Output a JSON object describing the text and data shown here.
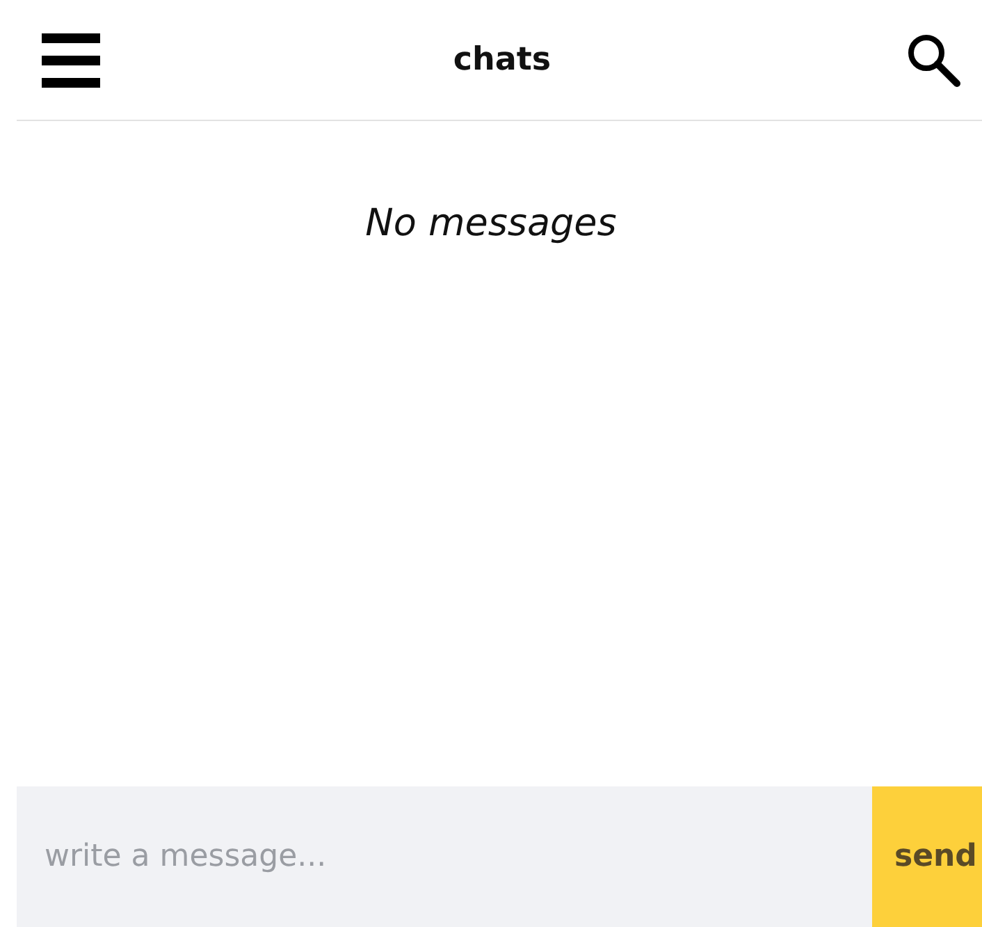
{
  "header": {
    "title": "chats"
  },
  "messages": {
    "empty_text": "No messages"
  },
  "composer": {
    "placeholder": "write a message...",
    "send_label": "send"
  }
}
